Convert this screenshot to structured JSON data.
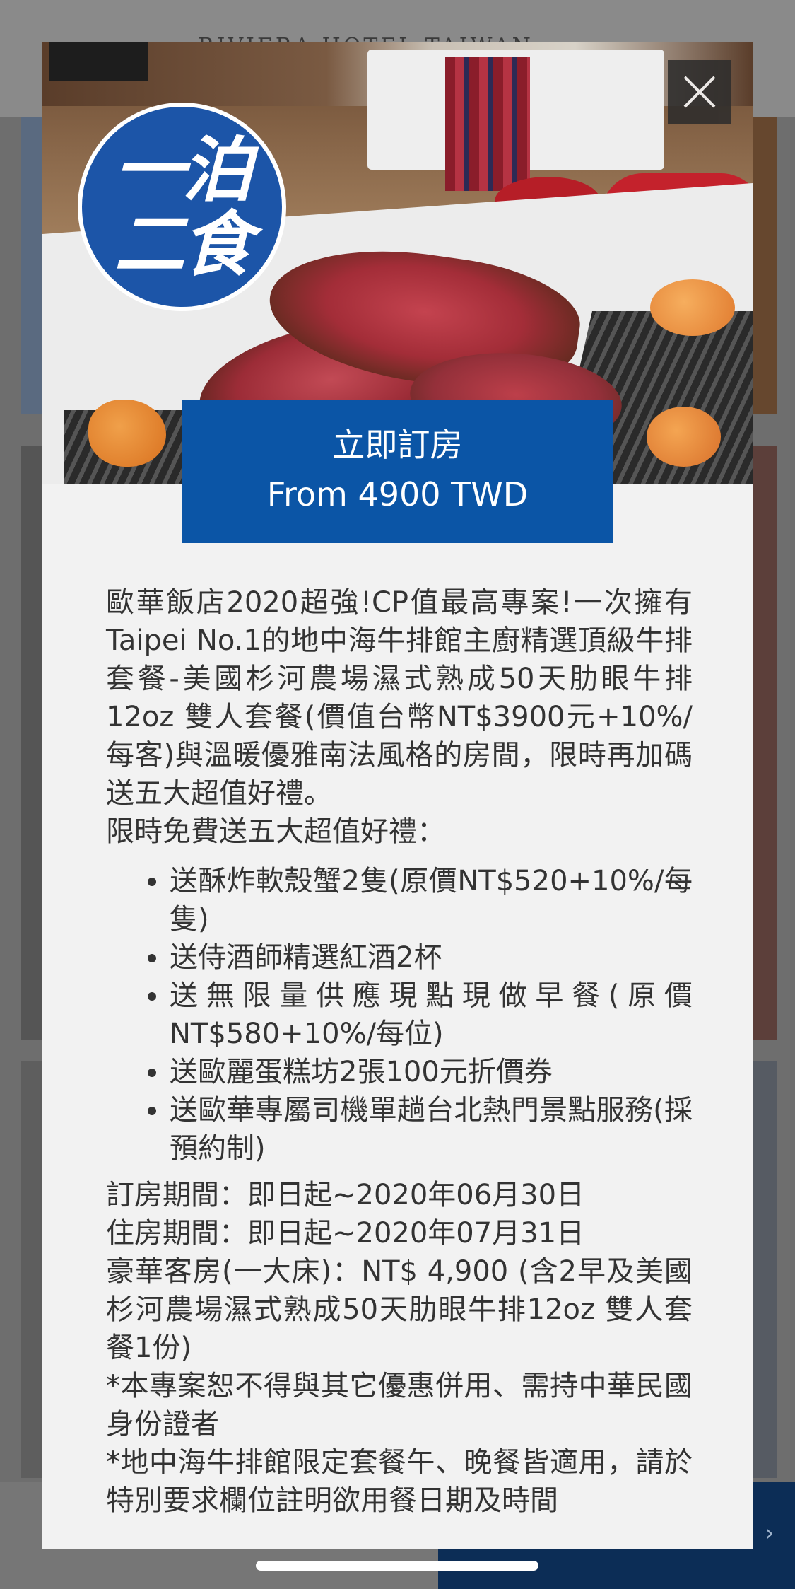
{
  "background": {
    "header_title": "RIVIERA HOTEL TAIWAN"
  },
  "modal": {
    "badge": {
      "line1": "一泊",
      "line2": "二食"
    },
    "book_cta": {
      "title": "立即訂房",
      "price": "From 4900 TWD"
    },
    "description": "歐華飯店2020超強!CP值最高專案!一次擁有Taipei No.1的地中海牛排館主廚精選頂級牛排套餐-美國杉河農場濕式熟成50天肋眼牛排12oz 雙人套餐(價值台幣NT$3900元+10%/每客)與溫暖優雅南法風格的房間，限時再加碼送五大超值好禮。",
    "gifts_heading": "限時免費送五大超值好禮：",
    "gifts": [
      "送酥炸軟殼蟹2隻(原價NT$520+10%/每隻)",
      "送侍酒師精選紅酒2杯",
      "送無限量供應現點現做早餐(原價NT$580+10%/每位)",
      "送歐麗蛋糕坊2張100元折價券",
      "送歐華專屬司機單趟台北熱門景點服務(採預約制)"
    ],
    "booking_period": "訂房期間：即日起~2020年06月30日",
    "stay_period": "住房期間：即日起~2020年07月31日",
    "room_price": "豪華客房(一大床)：NT$ 4,900 (含2早及美國杉河農場濕式熟成50天肋眼牛排12oz 雙人套餐1份)",
    "note1": "*本專案恕不得與其它優惠併用、需持中華民國身份證者",
    "note2": "*地中海牛排館限定套餐午、晚餐皆適用，請於特別要求欄位註明欲用餐日期及時間"
  },
  "icons": {
    "close": "close-icon",
    "footer_next": "chevron-right-icon"
  },
  "colors": {
    "cta_blue": "#0b55a6",
    "badge_blue": "#1c55a8",
    "modal_bg": "#f2f2f2",
    "text": "#333333"
  }
}
